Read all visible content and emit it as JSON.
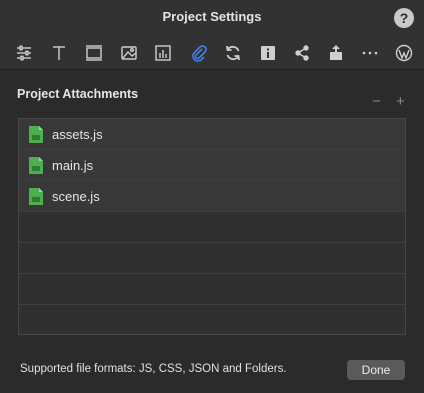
{
  "window": {
    "title": "Project Settings",
    "help_label": "?"
  },
  "toolbar": {
    "items": [
      {
        "icon": "sliders-icon",
        "active": false
      },
      {
        "icon": "text-icon",
        "active": false
      },
      {
        "icon": "frame-icon",
        "active": false
      },
      {
        "icon": "image-icon",
        "active": false
      },
      {
        "icon": "chart-icon",
        "active": false
      },
      {
        "icon": "paperclip-icon",
        "active": true
      },
      {
        "icon": "refresh-icon",
        "active": false
      },
      {
        "icon": "info-icon",
        "active": false
      },
      {
        "icon": "share-icon",
        "active": false
      },
      {
        "icon": "export-icon",
        "active": false
      },
      {
        "icon": "more-icon",
        "active": false
      },
      {
        "icon": "wordpress-icon",
        "active": false
      }
    ],
    "active_color": "#3b82f6",
    "icon_color": "#cfcfcf"
  },
  "attachments": {
    "title": "Project Attachments",
    "remove_label": "−",
    "add_label": "+",
    "files": [
      "assets.js",
      "main.js",
      "scene.js"
    ],
    "file_icon_color": "#4caf50"
  },
  "footer": {
    "supported_formats": "Supported file formats: JS, CSS, JSON and Folders.",
    "done_label": "Done"
  }
}
